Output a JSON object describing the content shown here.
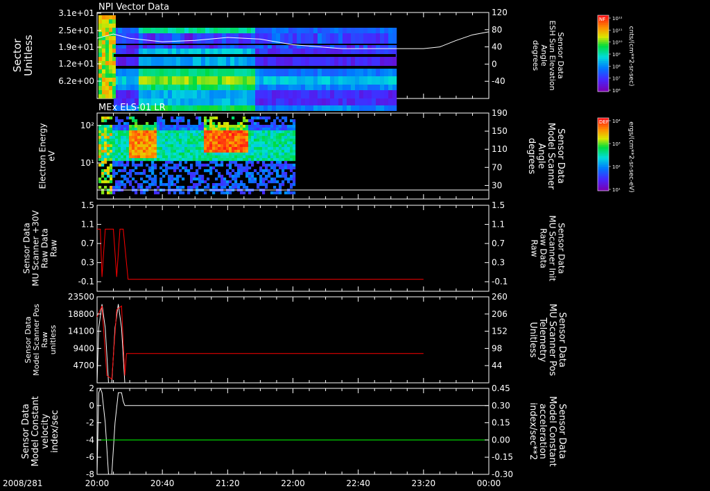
{
  "chart_data": [
    {
      "type": "heatmap",
      "title": "NPI Vector Data",
      "ylabel": [
        "Sector",
        "Unitless"
      ],
      "y_ticks": [
        "3.1e+01",
        "2.5e+01",
        "1.9e+01",
        "1.2e+01",
        "6.2e+00"
      ],
      "right_ticks": [
        "120",
        "80",
        "40",
        "0",
        "-40"
      ],
      "right_label": [
        "Sensor Data",
        "ESH Sun Elevation",
        "Angle",
        "degrees"
      ],
      "right_range": [
        -80,
        120
      ],
      "line_series": {
        "name": "ESH Sun Elevation Angle",
        "color": "#ffffff",
        "x_min": [
          0,
          10,
          20,
          40,
          60,
          80,
          100,
          120,
          150,
          170,
          185,
          200,
          210,
          220,
          230,
          240
        ],
        "y": [
          60,
          70,
          60,
          52,
          55,
          62,
          58,
          45,
          36,
          36,
          36,
          36,
          40,
          55,
          68,
          75
        ]
      },
      "colorbar": {
        "label": "NF",
        "units": "cnts/(cm**2-sr-sec)",
        "ticks": [
          "10¹²",
          "10¹¹",
          "10¹⁰",
          "10⁹",
          "10⁸",
          "10⁷",
          "10⁶"
        ]
      }
    },
    {
      "type": "heatmap",
      "title": "MEx ELS-01 LR",
      "ylabel": [
        "Electron Energy",
        "eV"
      ],
      "y_ticks": [
        "10²",
        "10¹"
      ],
      "right_ticks": [
        "190",
        "150",
        "110",
        "70",
        "30"
      ],
      "right_label": [
        "Sensor Data",
        "Model Scanner",
        "Angle",
        "degrees"
      ],
      "right_range": [
        0,
        190
      ],
      "colorbar": {
        "label": "DEF",
        "units": "ergs/(cm**2-sr-sec-eV)",
        "ticks": [
          "10⁴",
          "10³",
          "10²",
          "10¹"
        ]
      }
    },
    {
      "type": "line",
      "ylabel": [
        "Sensor Data",
        "MU Scanner +30V",
        "Raw Data",
        "Raw"
      ],
      "y_ticks": [
        "1.5",
        "1.1",
        "0.7",
        "0.3",
        "-0.1"
      ],
      "ylim": [
        -0.3,
        1.5
      ],
      "right_ticks": [
        "1.5",
        "1.1",
        "0.7",
        "0.3",
        "-0.1"
      ],
      "right_label": [
        "Sensor Data",
        "MU Scanner Init",
        "Raw Data",
        "Raw"
      ],
      "series": [
        {
          "color": "#ff0000",
          "x_min": [
            0,
            2,
            3,
            5,
            6,
            10,
            12,
            14,
            15,
            16,
            19,
            200
          ],
          "y": [
            1.0,
            1.0,
            0.0,
            1.0,
            1.0,
            1.0,
            0.0,
            1.0,
            1.0,
            1.0,
            -0.05,
            -0.05
          ]
        }
      ]
    },
    {
      "type": "line",
      "ylabel": [
        "Sensor Data",
        "Model Scanner Pos",
        "Raw",
        "unitless"
      ],
      "y_ticks": [
        "23500",
        "18800",
        "14100",
        "9400",
        "4700"
      ],
      "ylim": [
        0,
        23500
      ],
      "right_ticks": [
        "260",
        "206",
        "152",
        "98",
        "44"
      ],
      "right_label": [
        "Sensor Data",
        "MU Scanner Pos",
        "Telemetry",
        "Unitless"
      ],
      "right_range": [
        -10,
        260
      ],
      "series": [
        {
          "color": "#ffffff",
          "x_min": [
            0,
            1,
            3,
            5,
            7,
            9,
            11,
            13,
            15,
            17
          ],
          "y": [
            0,
            15000,
            21500,
            15000,
            0,
            0,
            15000,
            21500,
            15000,
            0
          ]
        },
        {
          "color": "#ff0000",
          "x_min": [
            0,
            3,
            6,
            9,
            12,
            15,
            17,
            18,
            200
          ],
          "y": [
            18000,
            21000,
            2000,
            1000,
            20000,
            21000,
            2000,
            8000,
            8000
          ]
        }
      ]
    },
    {
      "type": "line",
      "ylabel": [
        "Sensor Data",
        "Model Constant",
        "velocity",
        "index/sec"
      ],
      "y_ticks": [
        "2",
        "0",
        "-2",
        "-4",
        "-6",
        "-8"
      ],
      "ylim": [
        -8,
        2
      ],
      "right_ticks": [
        "0.45",
        "0.30",
        "0.15",
        "0.00",
        "-0.15",
        "-0.30"
      ],
      "right_label": [
        "Sensor Data",
        "Model Constant",
        "acceleration",
        "index/sec**2"
      ],
      "right_range": [
        -0.3,
        0.45
      ],
      "series": [
        {
          "color": "#ffffff",
          "x_min": [
            0,
            1,
            2,
            3,
            5,
            7,
            9,
            11,
            13,
            15,
            16,
            17,
            240
          ],
          "y": [
            -8,
            1.5,
            2,
            1.5,
            -2,
            -8,
            -8,
            -2,
            1.5,
            1.5,
            0.5,
            0,
            0
          ]
        },
        {
          "color": "#00ff00",
          "x_min": [
            0,
            240
          ],
          "y": [
            0.0,
            0.0
          ],
          "axis": "right"
        }
      ]
    }
  ],
  "x_axis": {
    "date": "2008/281",
    "ticks": [
      "20:00",
      "20:40",
      "21:20",
      "22:00",
      "22:40",
      "23:20",
      "00:00"
    ],
    "range_min": [
      0,
      240
    ]
  },
  "colors": {
    "background": "#000000",
    "axis": "#ffffff",
    "right_red": "#ff0000",
    "right_green": "#00ff00"
  }
}
